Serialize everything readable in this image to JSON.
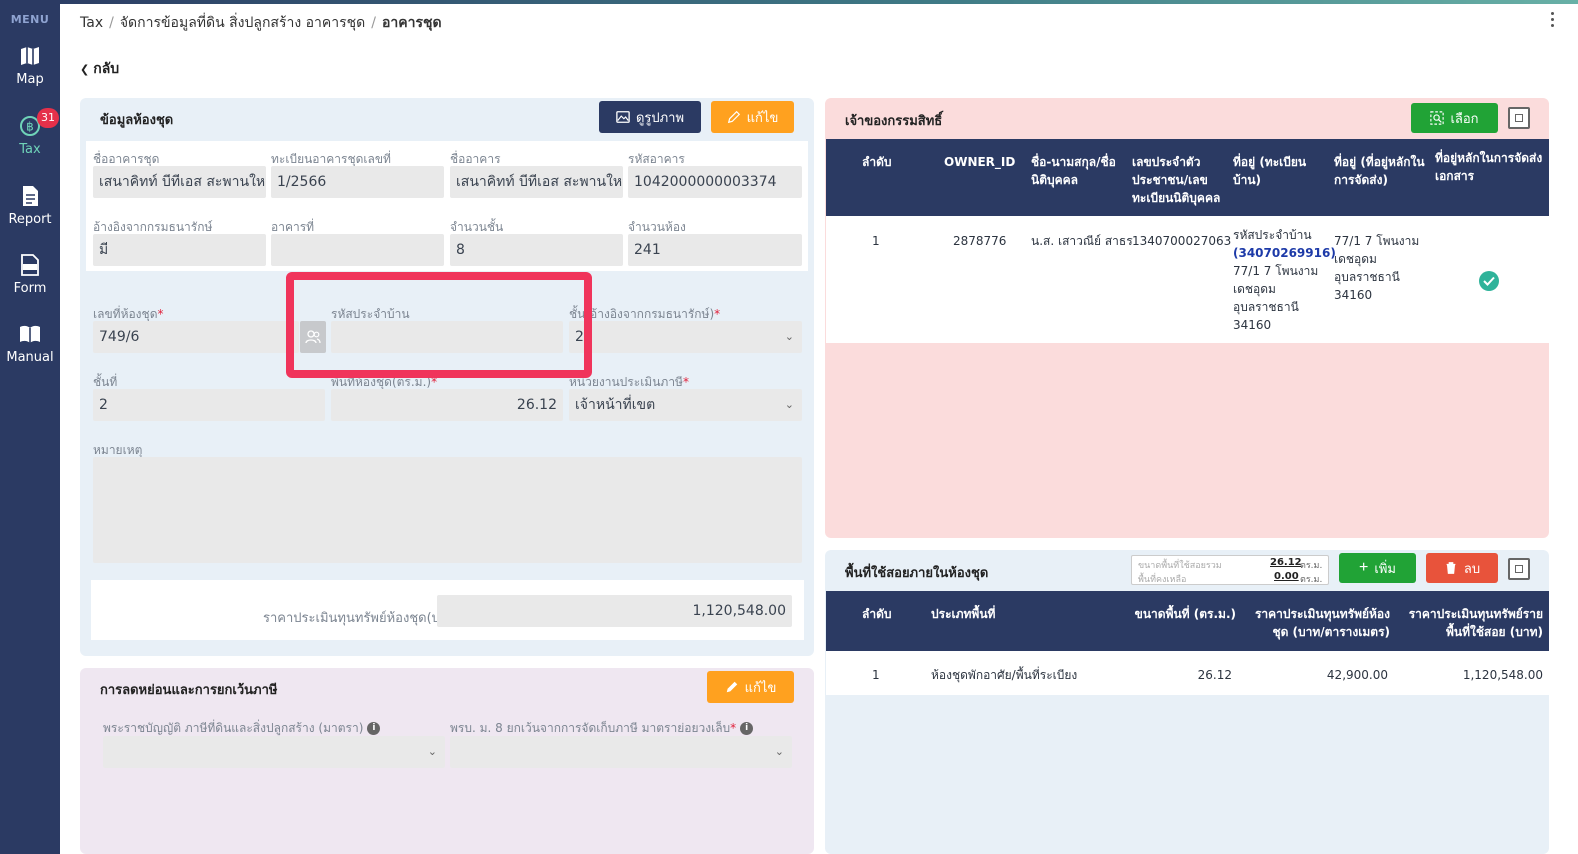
{
  "sidebar": {
    "menu_label": "MENU",
    "items": [
      {
        "label": "Map"
      },
      {
        "label": "Tax",
        "badge": "31"
      },
      {
        "label": "Report"
      },
      {
        "label": "Form"
      },
      {
        "label": "Manual"
      }
    ]
  },
  "breadcrumb": {
    "root": "Tax",
    "middle": "จัดการข้อมูลที่ดิน สิ่งปลูกสร้าง อาคารชุด",
    "current": "อาคารชุด"
  },
  "back_label": "กลับ",
  "room_info": {
    "title": "ข้อมูลห้องชุด",
    "view_image_label": "ดูรูปภาพ",
    "edit_label": "แก้ไข",
    "building_name_label": "ชื่ออาคารชุด",
    "building_name_value": "เสนาคิทท์ บีทีเอส สะพานใหม่",
    "registration_no_label": "ทะเบียนอาคารชุดเลขที่",
    "registration_no_value": "1/2566",
    "building_label": "ชื่ออาคาร",
    "building_value": "เสนาคิทท์ บีทีเอส สะพานใหม่",
    "building_code_label": "รหัสอาคาร",
    "building_code_value": "1042000000003374",
    "treasury_ref_label": "อ้างอิงจากกรมธนารักษ์",
    "treasury_ref_value": "มี",
    "building_no_label": "อาคารที่",
    "building_no_value": "",
    "floors_label": "จำนวนชั้น",
    "floors_value": "8",
    "rooms_label": "จำนวนห้อง",
    "rooms_value": "241",
    "room_no_label": "เลขที่ห้องชุด",
    "room_no_value": "749/6",
    "house_code_label": "รหัสประจำบ้าน",
    "house_code_value": "",
    "floor_ref_label_a": "ชั้น",
    "floor_ref_label_b": "(อ้างอิงจากกรมธนารักษ์)",
    "floor_ref_value": "2",
    "floor_label": "ชั้นที่",
    "floor_value": "2",
    "area_label": "พื้นที่ห้องชุด(ตร.ม.)",
    "area_value": "26.12",
    "assessor_label": "หน่วยงานประเมินภาษี",
    "assessor_value": "เจ้าหน้าที่เขต",
    "remark_label": "หมายเหตุ",
    "remark_value": "",
    "appraisal_label": "ราคาประเมินทุนทรัพย์ห้องชุด(บาท)",
    "appraisal_value": "1,120,548.00",
    "required_mark": "*"
  },
  "tax_reduction": {
    "title": "การลดหย่อนและการยกเว้นภาษี",
    "edit_label": "แก้ไข",
    "law_label": "พระราชบัญญัติ ภาษีที่ดินและสิ่งปลูกสร้าง (มาตรา)",
    "decree_label": "พรบ. ม. 8 ยกเว้นจากการจัดเก็บภาษี มาตราย่อยวงเล็บ",
    "info": "i"
  },
  "owners": {
    "title": "เจ้าของกรรมสิทธิ์",
    "select_label": "เลือก",
    "headers": [
      "ลำดับ",
      "OWNER_ID",
      "ชื่อ-นามสกุล/ชื่อนิติบุคคล",
      "เลขประจำตัวประชาชน/เลขทะเบียนนิติบุคคล",
      "ที่อยู่ (ทะเบียนบ้าน)",
      "ที่อยู่ (ที่อยู่หลักในการจัดส่ง)",
      "ที่อยู่หลักในการจัดส่งเอกสาร"
    ],
    "rows": [
      {
        "no": "1",
        "owner_id": "2878776",
        "name": "น.ส. เสาวณีย์ สาธร",
        "id_no": "1340700027063",
        "house_code_label": "รหัสประจำบ้าน",
        "house_code": "(34070269916)",
        "address": [
          "77/1 7 โพนงาม",
          "เดชอุดม",
          "อุบลราชธานี",
          "34160"
        ],
        "mail_address": [
          "77/1 7 โพนงาม",
          "เดชอุดม",
          "อุบลราชธานี",
          "34160"
        ]
      }
    ]
  },
  "usage": {
    "title": "พื้นที่ใช้สอยภายในห้องชุด",
    "total_label": "ขนาดพื้นที่ใช้สอยรวม",
    "total_value": "26.12",
    "remaining_label": "พื้นที่คงเหลือ",
    "remaining_value": "0.00",
    "unit": "ตร.ม.",
    "add_label": "เพิ่ม",
    "delete_label": "ลบ",
    "headers": [
      "ลำดับ",
      "ประเภทพื้นที่",
      "ขนาดพื้นที่ (ตร.ม.)",
      "ราคาประเมินทุนทรัพย์ห้องชุด (บาท/ตารางเมตร)",
      "ราคาประเมินทุนทรัพย์รายพื้นที่ใช้สอย (บาท)"
    ],
    "rows": [
      {
        "no": "1",
        "type": "ห้องชุดพักอาศัย/พื้นที่ระเบียง",
        "size": "26.12",
        "price_per_sqm": "42,900.00",
        "price": "1,120,548.00"
      }
    ]
  },
  "colors": {
    "navy": "#2b3a63",
    "orange": "#ffa11f",
    "green": "#21a336",
    "red": "#e8533b",
    "highlight": "#f0345b"
  }
}
